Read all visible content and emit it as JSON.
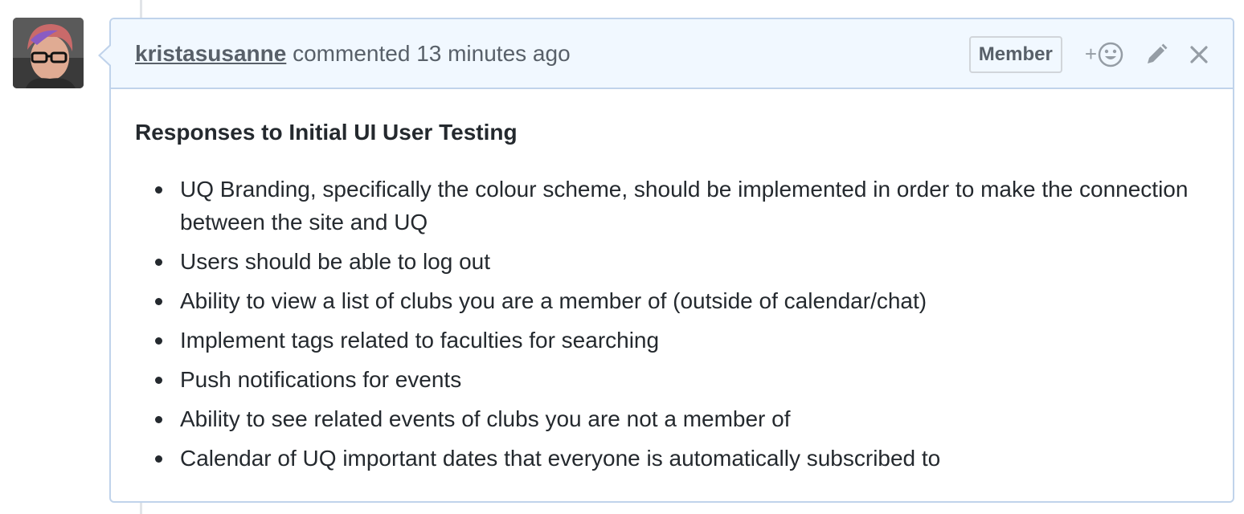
{
  "comment": {
    "author": "kristasusanne",
    "action": "commented",
    "time": "13 minutes ago",
    "badge": "Member",
    "reaction_plus": "+",
    "icons": {
      "reaction": "smiley-icon",
      "edit": "pencil-icon",
      "delete": "close-icon"
    },
    "colors": {
      "header_bg": "#f1f8ff",
      "border": "#c0d3eb",
      "text": "#24292e",
      "muted": "#586069"
    },
    "title": "Responses to Initial UI User Testing",
    "items": [
      "UQ Branding, specifically the colour scheme, should be implemented in order to make the connection between the site and UQ",
      "Users should be able to log out",
      "Ability to view a list of clubs you are a member of (outside of calendar/chat)",
      "Implement tags related to faculties for searching",
      "Push notifications for events",
      "Ability to see related events of clubs you are not a member of",
      "Calendar of UQ important dates that everyone is automatically subscribed to"
    ]
  }
}
